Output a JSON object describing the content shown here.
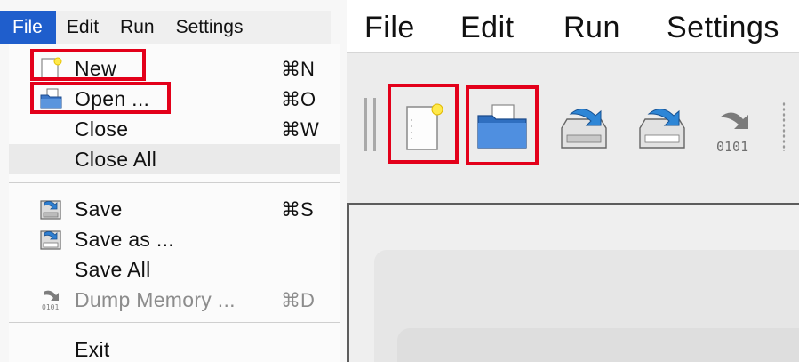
{
  "menubar": {
    "file": "File",
    "edit": "Edit",
    "run": "Run",
    "settings": "Settings"
  },
  "file_menu": {
    "items": [
      {
        "label": "New",
        "shortcut": "⌘N",
        "icon": "new-file-icon"
      },
      {
        "label": "Open ...",
        "shortcut": "⌘O",
        "icon": "open-folder-icon"
      },
      {
        "label": "Close",
        "shortcut": "⌘W"
      },
      {
        "label": "Close All",
        "shortcut": ""
      },
      {
        "label": "Save",
        "shortcut": "⌘S",
        "icon": "save-icon"
      },
      {
        "label": "Save as ...",
        "shortcut": "",
        "icon": "save-as-icon"
      },
      {
        "label": "Save All",
        "shortcut": ""
      },
      {
        "label": "Dump Memory ...",
        "shortcut": "⌘D",
        "icon": "dump-memory-icon",
        "disabled": true
      },
      {
        "label": "Exit",
        "shortcut": ""
      }
    ]
  },
  "toolbar": {
    "buttons": [
      "new-file-icon",
      "open-folder-icon",
      "save-icon",
      "save-as-icon",
      "dump-memory-icon"
    ],
    "dump_text": "0101"
  },
  "colors": {
    "menu_highlight": "#1f5ecc",
    "annotation_red": "#e3001a"
  }
}
